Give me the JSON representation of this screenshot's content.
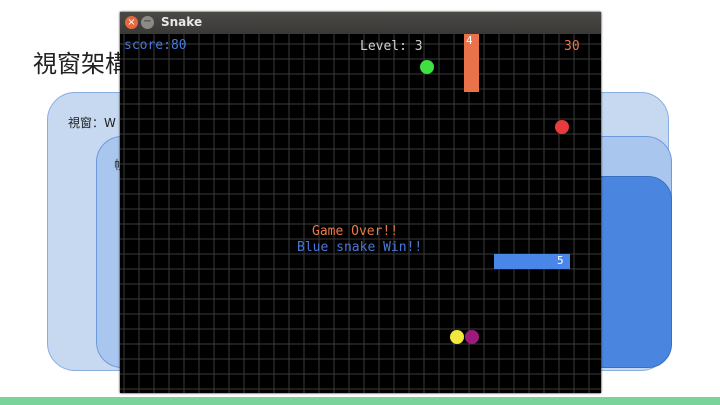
{
  "slide": {
    "title": "視窗架構",
    "outer_label": "視窗：W",
    "mid_label": "帧"
  },
  "window": {
    "title": "Snake",
    "close_glyph": "×",
    "minimize_glyph": "−"
  },
  "hud": {
    "score_text": "score:80",
    "level_text": "Level: 3",
    "timer": "30"
  },
  "messages": {
    "game_over": "Game Over!!",
    "winner": "Blue snake Win!!"
  },
  "snakes": [
    {
      "name": "orange",
      "color": "#e8724a",
      "length": "4"
    },
    {
      "name": "blue",
      "color": "#4a86e8",
      "length": "5"
    }
  ],
  "food": [
    {
      "color": "#3fe03f"
    },
    {
      "color": "#e83c3c"
    },
    {
      "color": "#f0e83c"
    },
    {
      "color": "#9c1a7c"
    }
  ],
  "colors": {
    "grid": "#3a3a3a",
    "accent_bottom": "#79d39a"
  }
}
